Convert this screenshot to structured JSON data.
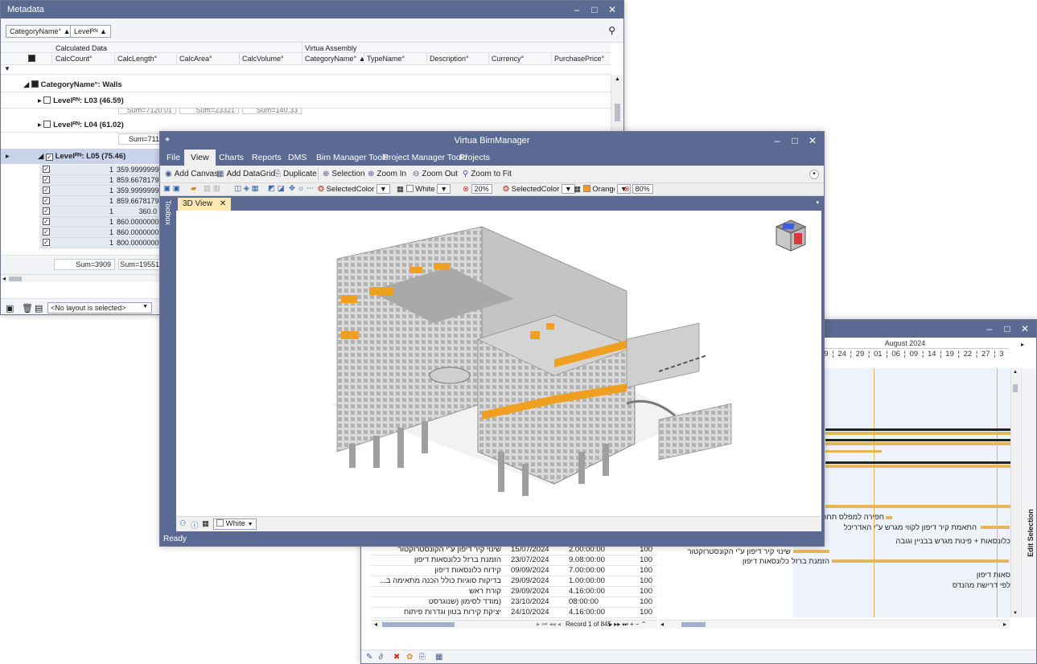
{
  "metadata": {
    "title": "Metadata",
    "group_chips": [
      "CategoryName°",
      "Levelᴿᴺ"
    ],
    "header_groups": [
      "Calculated Data",
      "Virtua Assembly"
    ],
    "columns": [
      "CalcCount°",
      "CalcLength°",
      "CalcArea°",
      "CalcVolume°",
      "CategoryName°",
      "TypeName°",
      "Description°",
      "Currency°",
      "PurchasePrice°"
    ],
    "groups": {
      "walls": "CategoryName°: Walls",
      "l03": "Levelᴿᴺ: L03 (46.59)",
      "l04": "Levelᴿᴺ: L04 (61.02)",
      "l05": "Levelᴿᴺ: L05 (75.46)"
    },
    "partial_sums": [
      "Sum=7120.01",
      "Sum=23321",
      "Sum=140.33"
    ],
    "l04_sum": "Sum=711",
    "rows": [
      {
        "count": "1",
        "length": "359.9999999"
      },
      {
        "count": "1",
        "length": "859.6678179"
      },
      {
        "count": "1",
        "length": "359.9999999"
      },
      {
        "count": "1",
        "length": "859.6678179"
      },
      {
        "count": "1",
        "length": "360.0"
      },
      {
        "count": "1",
        "length": "860.0000000"
      },
      {
        "count": "1",
        "length": "860.0000000"
      },
      {
        "count": "1",
        "length": "800.0000000"
      }
    ],
    "sum_count": "Sum=3909",
    "sum_length": "Sum=19551",
    "layout_select": "<No layout is selected>"
  },
  "bim": {
    "title": "Virtua BimManager",
    "menu": [
      "File",
      "View",
      "Charts",
      "Reports",
      "DMS",
      "Bim Manager Tools",
      "Project Manager Toold",
      "Projects"
    ],
    "ribbon": [
      "Add Canvas",
      "Add DataGrid",
      "Duplicate",
      "Selection",
      "Zoom In",
      "Zoom Out",
      "Zoom to Fit"
    ],
    "selected_color_1": "SelectedColor",
    "color_1": "White",
    "pct_1": "20%",
    "selected_color_2": "SelectedColor",
    "color_2": "Orange",
    "pct_2": "80%",
    "toolbox": "Toolbox",
    "tab": "3D View",
    "footer_color": "White",
    "status": "Ready",
    "colors": {
      "highlight": "#f0a020",
      "chrome": "#5b6a93"
    }
  },
  "gantt": {
    "month": "August 2024",
    "days": [
      "19",
      "24",
      "29",
      "01",
      "06",
      "09",
      "14",
      "19",
      "22",
      "27",
      "3"
    ],
    "edit_selection": "Edit Selection",
    "chart_labels": [
      "חפירה למפלס תחתית",
      "התאמת קיר דיפון לקווי מגרש ע\"י האדריכל",
      "כלונסאות + פינות מגרש בבניין וגובה",
      "שינוי קיר דיפון ע\"י הקונסטרוקטור",
      "הזמנת ברזל כלונסאות דיפון",
      "סאות דיפון",
      "לפי דרישת מהנדס"
    ],
    "rows": [
      {
        "name": "שינוי קיר דיפון ע\"י הקונסטרוקטור",
        "date": "15/07/2024",
        "duration": "2.00:00:00",
        "pct": "100"
      },
      {
        "name": "הזמנת ברזל כלונסאות דיפון",
        "date": "23/07/2024",
        "duration": "9.08:00:00",
        "pct": "100"
      },
      {
        "name": "קידוח כלונסאות דיפון",
        "date": "09/09/2024",
        "duration": "7.00:00:00",
        "pct": "100"
      },
      {
        "name": "בדיקות סוגיות כולל הכנה מתאימה ב...",
        "date": "29/09/2024",
        "duration": "1.00:00:00",
        "pct": "100"
      },
      {
        "name": "קורת ראש",
        "date": "29/09/2024",
        "duration": "4.16:00:00",
        "pct": "100"
      },
      {
        "name": "(מודד לסימון (שנוגרסט",
        "date": "23/10/2024",
        "duration": "08:00:00",
        "pct": "100"
      },
      {
        "name": "יציקת קירות בטון וגדרות פיתוח",
        "date": "24/10/2024",
        "duration": "4.16:00:00",
        "pct": "100"
      }
    ],
    "record_nav": "Record 1 of 845",
    "colors": {
      "bar": "#e5b75c",
      "grid_bg": "#eef3fb"
    }
  }
}
